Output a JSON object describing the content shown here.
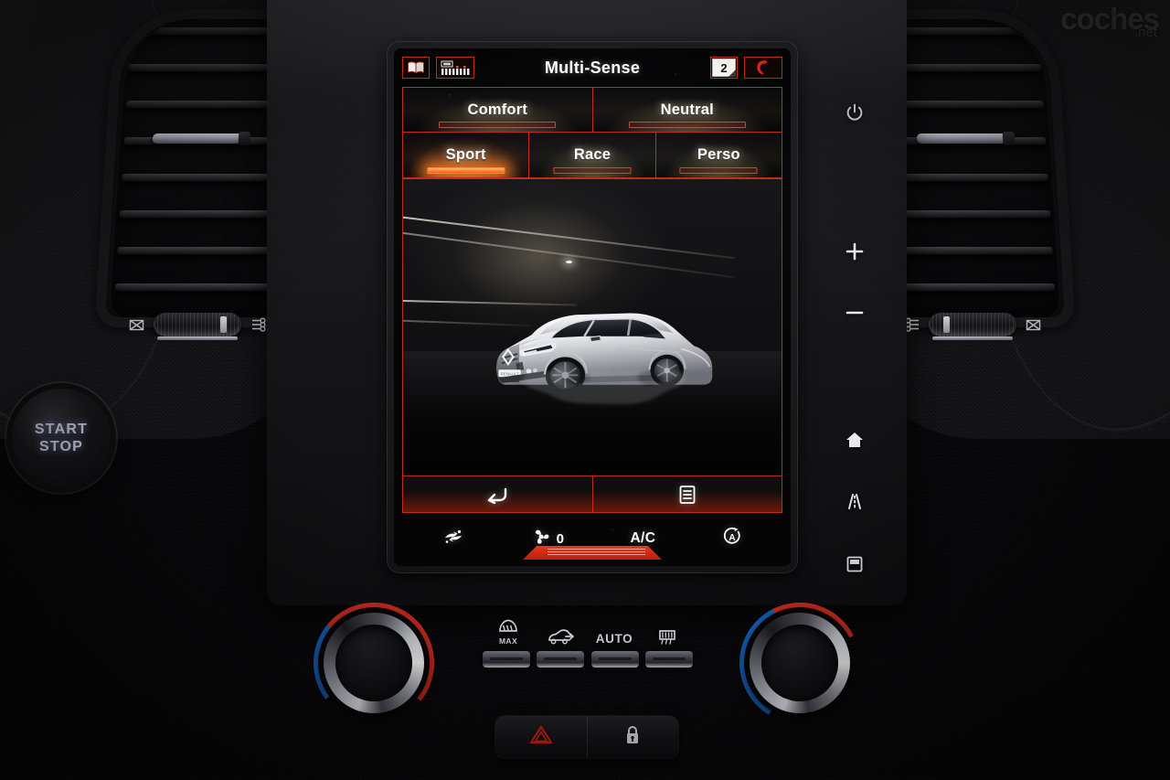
{
  "screen": {
    "status_bar": {
      "title": "Multi-Sense",
      "left_icons": [
        {
          "name": "map-book-icon",
          "glyph": "▧"
        },
        {
          "name": "media-equalizer-icon",
          "glyph": "░"
        }
      ],
      "page_badge": "2",
      "phone_icon": "☎"
    },
    "modes": {
      "row1": [
        {
          "label": "Comfort",
          "selected": false
        },
        {
          "label": "Neutral",
          "selected": false
        }
      ],
      "row2": [
        {
          "label": "Sport",
          "selected": true
        },
        {
          "label": "Race",
          "selected": false
        },
        {
          "label": "Perso",
          "selected": false
        }
      ]
    },
    "vehicle_image": {
      "description": "White Renault Megane R.S. hatchback, front three-quarter view, dark studio with light streaks",
      "plate_text": "RENAULT"
    },
    "softkeys": [
      {
        "name": "back-softkey",
        "icon": "back-arrow-icon"
      },
      {
        "name": "menu-softkey",
        "icon": "list-menu-icon"
      }
    ],
    "climate_strip": [
      {
        "name": "recirculation-button",
        "icon": "recirculation-icon",
        "label": ""
      },
      {
        "name": "fan-speed-button",
        "icon": "fan-icon",
        "label": "0"
      },
      {
        "name": "ac-button",
        "icon": "",
        "label": "A/C"
      },
      {
        "name": "auto-stop-button",
        "icon": "auto-circle-icon",
        "label": ""
      }
    ]
  },
  "hardware_buttons": [
    {
      "name": "power-button",
      "icon": "power-icon"
    },
    {
      "name": "volume-up-button",
      "icon": "plus-icon",
      "label": "+"
    },
    {
      "name": "volume-down-button",
      "icon": "minus-icon",
      "label": "−"
    },
    {
      "name": "home-button",
      "icon": "home-icon"
    },
    {
      "name": "navigation-button",
      "icon": "road-icon"
    },
    {
      "name": "display-button",
      "icon": "screen-icon"
    }
  ],
  "ignition": {
    "line1": "START",
    "line2": "STOP"
  },
  "climate_panel": {
    "buttons": [
      {
        "name": "max-defrost-button",
        "icon": "windshield-defrost-icon",
        "sub": "MAX"
      },
      {
        "name": "recirculation-button",
        "icon": "car-recirculation-icon",
        "sub": ""
      },
      {
        "name": "auto-button",
        "icon": "",
        "text": "AUTO"
      },
      {
        "name": "rear-defrost-button",
        "icon": "rear-defrost-icon",
        "sub": ""
      }
    ],
    "left_knob": {
      "name": "driver-temperature-knob"
    },
    "right_knob": {
      "name": "passenger-temperature-knob"
    }
  },
  "lower_buttons": [
    {
      "name": "hazard-lights-button",
      "icon": "warning-triangle-icon"
    },
    {
      "name": "door-lock-button",
      "icon": "lock-icon"
    }
  ],
  "vents": {
    "left": {
      "close_icon": "vent-closed-icon",
      "flow_icon": "airflow-icon"
    },
    "right": {
      "close_icon": "vent-closed-icon",
      "flow_icon": "airflow-icon"
    }
  },
  "watermark": {
    "main": "coches",
    "sub": ".net"
  },
  "colors": {
    "accent_red": "#c32d18",
    "accent_orange": "#ff7a28",
    "screen_bg": "#09090b",
    "hot": "#d42b1e",
    "cold": "#1565c0"
  }
}
